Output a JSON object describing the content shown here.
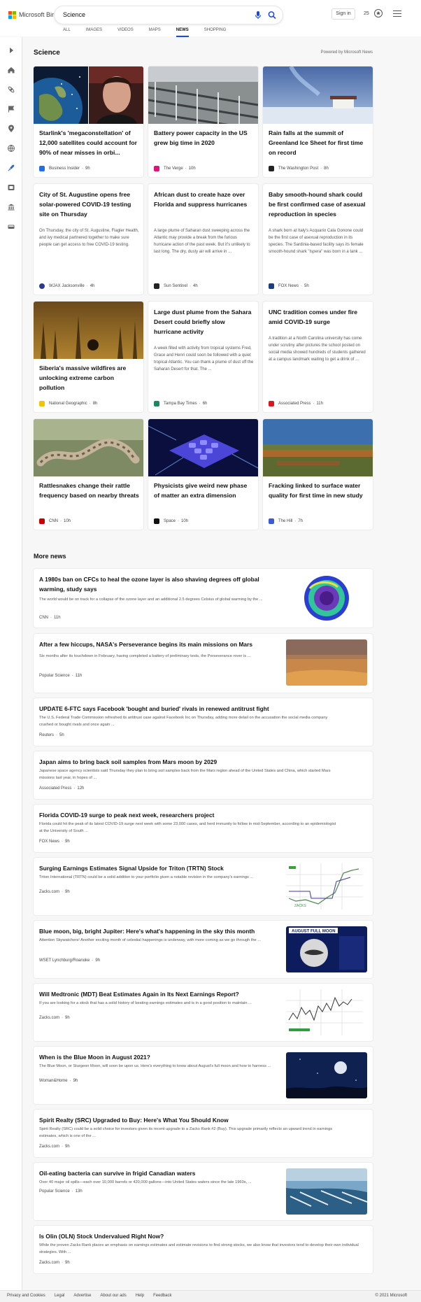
{
  "header": {
    "logo_text": "Microsoft Bing",
    "search_value": "Science",
    "sign_in": "Sign in",
    "rewards_points": "25",
    "scopes": [
      "ALL",
      "IMAGES",
      "VIDEOS",
      "MAPS",
      "NEWS",
      "SHOPPING"
    ],
    "active_scope": "NEWS"
  },
  "section": {
    "title": "Science",
    "powered_by": "Powered by Microsoft News"
  },
  "cards": [
    {
      "title": "Starlink's 'megaconstellation' of 12,000 satellites could account for 90% of near misses in orbi...",
      "desc": "",
      "source": "Business Insider",
      "time": "9h",
      "logo_color": "#1f6fe5"
    },
    {
      "title": "Battery power capacity in the US grew big time in 2020",
      "desc": "",
      "source": "The Verge",
      "time": "10h",
      "logo_color": "#e2127a"
    },
    {
      "title": "Rain falls at the summit of Greenland Ice Sheet for first time on record",
      "desc": "",
      "source": "The Washington Post",
      "time": "8h",
      "logo_color": "#222222"
    },
    {
      "title": "City of St. Augustine opens free solar-powered COVID-19 testing site on Thursday",
      "desc": "On Thursday, the city of St. Augustine, Flagler Health, and ivy medical partnered together to make sure people can get access to free COVID-19 testing.",
      "source": "WJAX Jacksonville",
      "time": "4h",
      "logo_color": "#2b3a8f"
    },
    {
      "title": "African dust to create haze over Florida and suppress hurricanes",
      "desc": "A large plume of Saharan dust sweeping across the Atlantic may provide a break from the furious hurricane action of the past week. But it's unlikely to last long. The dry, dusty air will arrive in ...",
      "source": "Sun Sentinel",
      "time": "4h",
      "logo_color": "#222222"
    },
    {
      "title": "Baby smooth-hound shark could be first confirmed case of asexual reproduction in species",
      "desc": "A shark born at Italy's Acquario Cala Gonone could be the first case of asexual reproduction in its species. The Sardinia-based facility says its female smooth-hound shark \"Ispera\" was born in a tank ...",
      "source": "FOX News",
      "time": "5h",
      "logo_color": "#1d3e7c"
    },
    {
      "title": "Siberia's massive wildfires are unlocking extreme carbon pollution",
      "desc": "",
      "source": "National Geographic",
      "time": "8h",
      "logo_color": "#f5c400"
    },
    {
      "title": "Large dust plume from the Sahara Desert could briefly slow hurricane activity",
      "desc": "A week filled with activity from tropical systems Fred, Grace and Henri could soon be followed with a quiet tropical Atlantic. You can thank a plume of dust off the Saharan Desert for that. The ...",
      "source": "Tampa Bay Times",
      "time": "6h",
      "logo_color": "#1a8a5a"
    },
    {
      "title": "UNC tradition comes under fire amid COVID-19 surge",
      "desc": "A tradition at a North Carolina university has come under scrutiny after pictures the school posted on social media showed hundreds of students gathered at a campus landmark waiting to get a drink of ...",
      "source": "Associated Press",
      "time": "11h",
      "logo_color": "#d7191c"
    },
    {
      "title": "Rattlesnakes change their rattle frequency based on nearby threats",
      "desc": "",
      "source": "CNN",
      "time": "10h",
      "logo_color": "#cc0000"
    },
    {
      "title": "Physicists give weird new phase of matter an extra dimension",
      "desc": "",
      "source": "Space",
      "time": "10h",
      "logo_color": "#111111"
    },
    {
      "title": "Fracking linked to surface water quality for first time in new study",
      "desc": "",
      "source": "The Hill",
      "time": "7h",
      "logo_color": "#3b5bd6"
    }
  ],
  "more_news": {
    "title": "More news",
    "items": [
      {
        "title": "A 1980s ban on CFCs to heal the ozone layer is also shaving degrees off global warming, study says",
        "desc": "The world would be on track for a collapse of the ozone layer and an additional 2.5 degrees Celsius of global warming by the ...",
        "source": "CNN",
        "time": "11h",
        "logo_color": "#cc0000"
      },
      {
        "title": "After a few hiccups, NASA's Perseverance begins its main missions on Mars",
        "desc": "Six months after its touchdown in February, having completed a battery of preliminary tests, the Perseverance rover is ...",
        "source": "Popular Science",
        "time": "11h",
        "logo_color": "#e8452c"
      },
      {
        "title": "UPDATE 6-FTC says Facebook 'bought and buried' rivals in renewed antitrust fight",
        "desc": "The U.S. Federal Trade Commission refreshed its antitrust case against Facebook Inc on Thursday, adding more detail on the accusation the social media company crushed or bought rivals and once again ...",
        "source": "Reuters",
        "time": "5h",
        "logo_color": "#f08a24"
      },
      {
        "title": "Japan aims to bring back soil samples from Mars moon by 2029",
        "desc": "Japanese space agency scientists said Thursday they plan to bring soil samples back from the Mars region ahead of the United States and China, which started Mars missions last year, in hopes of ...",
        "source": "Associated Press",
        "time": "12h",
        "logo_color": "#d7191c"
      },
      {
        "title": "Florida COVID-19 surge to peak next week, researchers project",
        "desc": "Florida could hit the peak of its latest COVID-19 surge next week with some 23,000 cases, and herd immunity to follow in mid-September, according to an epidemiologist at the University of South ...",
        "source": "FOX News",
        "time": "9h",
        "logo_color": "#1d3e7c"
      },
      {
        "title": "Surging Earnings Estimates Signal Upside for Triton (TRTN) Stock",
        "desc": "Triton International (TRTN) could be a solid addition to your portfolio given a notable revision in the company's earnings ...",
        "source": "Zacks.com",
        "time": "9h",
        "logo_color": "#2e9e3e"
      },
      {
        "title": "Blue moon, big, bright Jupiter: Here's what's happening in the sky this month",
        "desc": "Attention Skywatchers! Another exciting month of celestial happenings is underway, with more coming as we go through the ...",
        "source": "WSET Lynchburg/Roanoke",
        "time": "9h",
        "logo_color": "#1f4aa8"
      },
      {
        "title": "Will Medtronic (MDT) Beat Estimates Again in Its Next Earnings Report?",
        "desc": "If you are looking for a stock that has a solid history of beating earnings estimates and is in a good position to maintain ...",
        "source": "Zacks.com",
        "time": "9h",
        "logo_color": "#2e9e3e"
      },
      {
        "title": "When is the Blue Moon in August 2021?",
        "desc": "The Blue Moon, or Sturgeon Moon, will soon be upon us. Here's everything to know about August's full moon and how to harness ...",
        "source": "Woman&Home",
        "time": "9h",
        "logo_color": "#222222"
      },
      {
        "title": "Spirit Realty (SRC) Upgraded to Buy: Here's What You Should Know",
        "desc": "Spirit Realty (SRC) could be a solid choice for investors given its recent upgrade to a Zacks Rank #2 (Buy). This upgrade primarily reflects an upward trend in earnings estimates, which is one of the ...",
        "source": "Zacks.com",
        "time": "9h",
        "logo_color": "#2e9e3e"
      },
      {
        "title": "Oil-eating bacteria can survive in frigid Canadian waters",
        "desc": "Over 40 major oil spills—each over 10,000 barrels or 420,000 gallons—into United States waters since the late 1960s, ...",
        "source": "Popular Science",
        "time": "13h",
        "logo_color": "#e8452c"
      },
      {
        "title": "Is Olin (OLN) Stock Undervalued Right Now?",
        "desc": "While the proven Zacks Rank places an emphasis on earnings estimates and estimate revisions to find strong stocks, we also know that investors tend to develop their own individual strategies. With ...",
        "source": "Zacks.com",
        "time": "9h",
        "logo_color": "#2e9e3e"
      }
    ],
    "thumb_labels": {
      "moon_card": "AUGUST FULL MOON",
      "zacks": "ZACKS"
    }
  },
  "footer": {
    "links": [
      "Privacy and Cookies",
      "Legal",
      "Advertise",
      "About our ads",
      "Help",
      "Feedback"
    ],
    "copyright": "© 2021 Microsoft"
  }
}
